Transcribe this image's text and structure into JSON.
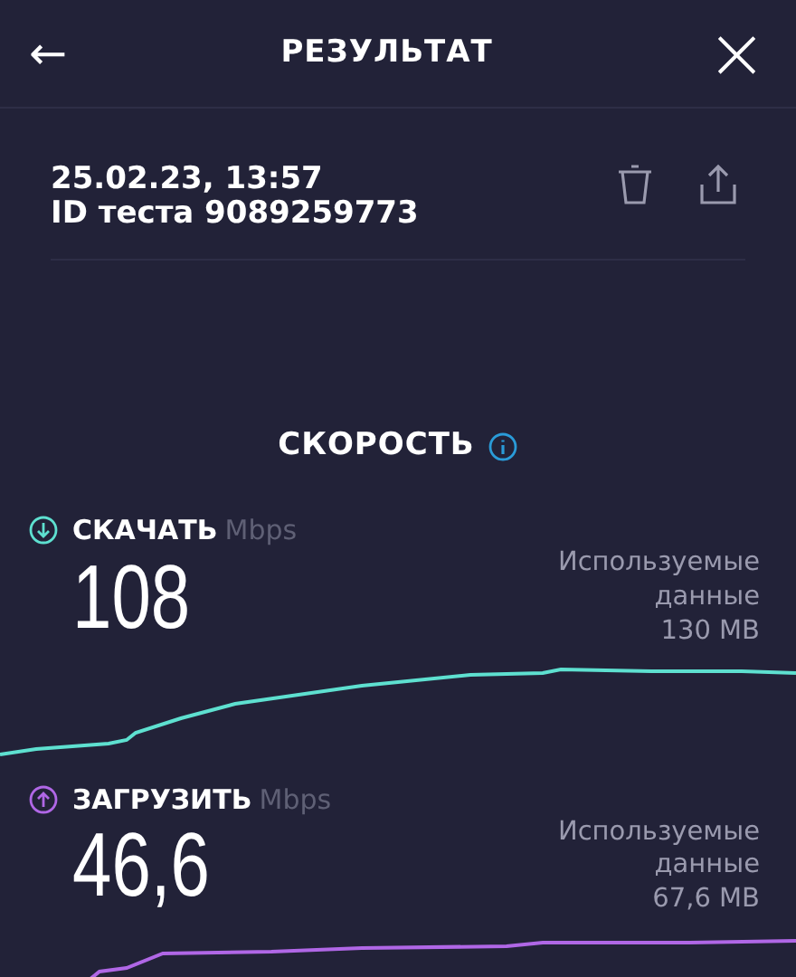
{
  "header": {
    "title": "РЕЗУЛЬТАТ",
    "back": "←",
    "close": "×"
  },
  "test": {
    "datetime": "25.02.23, 13:57",
    "id": "ID теста 9089259773"
  },
  "section": {
    "title": "СКОРОСТЬ"
  },
  "metrics": [
    {
      "kind": "download",
      "label": "СКАЧАТЬ",
      "unit": "Mbps",
      "value": "108",
      "data_label": "Используемые данные",
      "data_value": "130 MB",
      "color": "#5ee0d0"
    },
    {
      "kind": "upload",
      "label": "ЗАГРУЗИТЬ",
      "unit": "Mbps",
      "value": "46,6",
      "data_label": "Используемые данные",
      "data_value": "67,6 MB",
      "color": "#b067e6"
    }
  ]
}
